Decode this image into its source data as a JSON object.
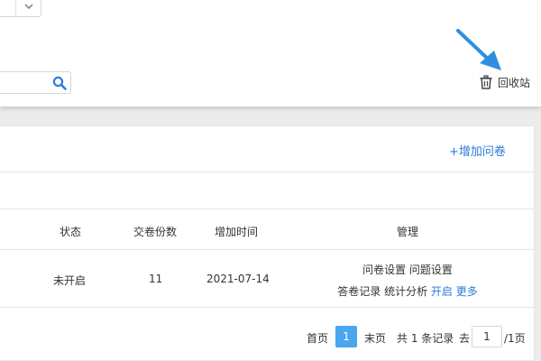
{
  "toolbar": {
    "recycle_bin_label": "回收站"
  },
  "list": {
    "add_label": "+增加问卷",
    "columns": {
      "status": "状态",
      "submissions": "交卷份数",
      "added_time": "增加时间",
      "manage": "管理"
    },
    "rows": [
      {
        "status": "未开启",
        "submissions": "11",
        "added_time": "2021-07-14",
        "actions": {
          "survey_settings": "问卷设置",
          "question_settings": "问题设置",
          "answer_records": "答卷记录",
          "statistics": "统计分析",
          "open": "开启",
          "more": "更多"
        }
      }
    ]
  },
  "pagination": {
    "first": "首页",
    "current": "1",
    "last": "末页",
    "total": "共 1 条记录",
    "goto": "去",
    "goto_value": "1",
    "total_pages": "/1页"
  },
  "colors": {
    "accent": "#2d7ad8",
    "pager_active": "#4aa6ee",
    "arrow": "#2e8fe0"
  },
  "icons": [
    "chevron-down-icon",
    "search-icon",
    "arrow-icon",
    "trash-icon"
  ]
}
